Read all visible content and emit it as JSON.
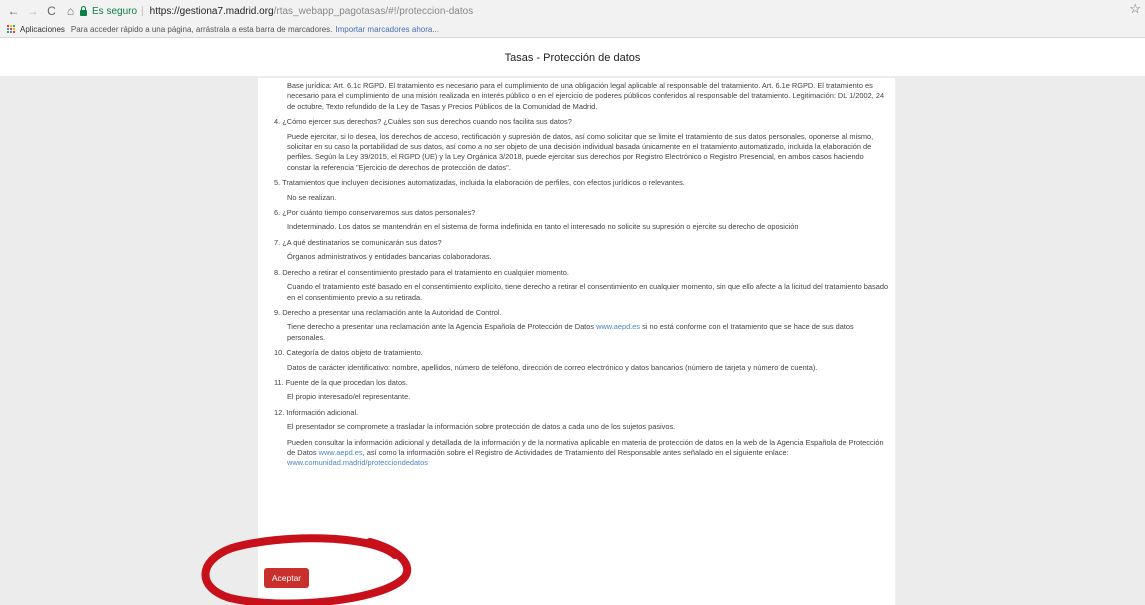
{
  "browser": {
    "nav_back": "←",
    "nav_forward": "→",
    "nav_reload": "C",
    "nav_home": "⌂",
    "secure_label": "Es seguro",
    "url_host": "https://gestiona7.madrid.org",
    "url_path": "/rtas_webapp_pagotasas/#!/proteccion-datos",
    "star": "☆",
    "bookmarks": {
      "apps_label": "Aplicaciones",
      "hint": "Para acceder rápido a una página, arrástrala a esta barra de marcadores.",
      "import_link": "Importar marcadores ahora..."
    }
  },
  "page": {
    "title": "Tasas - Protección de datos"
  },
  "content": {
    "legal_basis_1": "Base jurídica: Art. 6.1c RGPD. El tratamiento es necesario para el cumplimiento de una obligación legal aplicable al responsable del tratamiento. Art. 6.1e RGPD. El tratamiento es necesario para el cumplimiento de una misión realizada en interés público o en el ejercicio de poderes públicos conferidos al responsable del tratamiento. Legitimación: DL 1/2002, 24 de octubre, Texto refundido de la Ley de Tasas y Precios Públicos de la Comunidad de Madrid.",
    "q4": "4. ¿Cómo ejercer sus derechos? ¿Cuáles son sus derechos cuando nos facilita sus datos?",
    "a4": "Puede ejercitar, si lo desea, los derechos de acceso, rectificación y supresión de datos, así como solicitar que se limite el tratamiento de sus datos personales, oponerse al mismo, solicitar en su caso la portabilidad de sus datos, así como a no ser objeto de una decisión individual basada únicamente en el tratamiento automatizado, incluida la elaboración de perfiles. Según la Ley 39/2015, el RGPD (UE) y la Ley Orgánica 3/2018, puede ejercitar sus derechos por Registro Electrónico o Registro Presencial, en ambos casos haciendo constar la referencia \"Ejercicio de derechos de protección de datos\".",
    "q5": "5. Tratamientos que incluyen decisiones automatizadas, incluida la elaboración de perfiles, con efectos jurídicos o relevantes.",
    "a5": "No se realizan.",
    "q6": "6. ¿Por cuánto tiempo conservaremos sus datos personales?",
    "a6": "Indeterminado. Los datos se mantendrán en el sistema de forma indefinida en tanto el interesado no solicite su supresión o ejercite su derecho de oposición",
    "q7": "7. ¿A qué destinatarios se comunicarán sus datos?",
    "a7": "Órganos administrativos y entidades bancarias colaboradoras.",
    "q8": "8. Derecho a retirar el consentimiento prestado para el tratamiento en cualquier momento.",
    "a8": "Cuando el tratamiento esté basado en el consentimiento explícito, tiene derecho a retirar el consentimiento en cualquier momento, sin que ello afecte a la licitud del tratamiento basado en el consentimiento previo a su retirada.",
    "q9": "9. Derecho a presentar una reclamación ante la Autoridad de Control.",
    "a9_before": "Tiene derecho a presentar una reclamación ante la Agencia Española de Protección de Datos ",
    "a9_link": "www.aepd.es",
    "a9_after": " si no está conforme con el tratamiento que se hace de sus datos personales.",
    "q10": "10. Categoría de datos objeto de tratamiento.",
    "a10": "Datos de carácter identificativo: nombre, apellidos, número de teléfono, dirección de correo electrónico y datos bancarios (número de tarjeta y número de cuenta).",
    "q11": "11. Fuente de la que procedan los datos.",
    "a11": "El propio interesado/el representante.",
    "q12": "12. Información adicional.",
    "a12a": "El presentador se compromete a trasladar la información sobre protección de datos a cada uno de los sujetos pasivos.",
    "a12b_1": "Pueden consultar la información adicional y detallada de la información y de la normativa aplicable en materia de protección de datos en la web de la Agencia Española de Protección de Datos ",
    "a12b_link1": "www.aepd.es",
    "a12b_2": ", así como la información sobre el Registro de Actividades de Tratamiento del Responsable antes señalado en el siguiente enlace: ",
    "a12b_link2": "www.comunidad.madrid/protecciondedatos"
  },
  "actions": {
    "accept_label": "Aceptar"
  },
  "colors": {
    "accept_button": "#c9302c",
    "annotation_circle": "#c8101a",
    "link": "#4a86c5",
    "secure": "#0b8043"
  }
}
